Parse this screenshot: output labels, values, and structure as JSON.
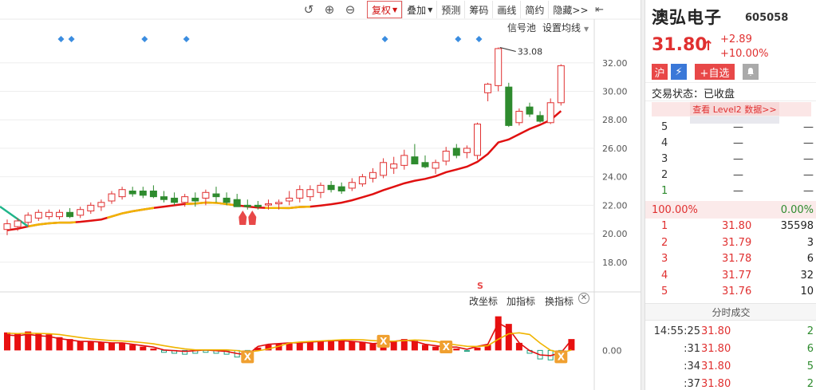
{
  "toolbar": {
    "undo_icon": "undo-icon",
    "zoom_in_icon": "zoom-in-icon",
    "zoom_out_icon": "zoom-out-icon",
    "buttons": [
      "复权",
      "叠加",
      "预测",
      "筹码",
      "画线",
      "简约",
      "隐藏>>"
    ]
  },
  "chart_labels": {
    "signal_pool": "信号池",
    "ma_settings": "设置均线",
    "peak_label": "33.08",
    "change_axis": "改坐标",
    "add_indicator": "加指标",
    "switch_indicator": "换指标",
    "s_marker": "S"
  },
  "colors": {
    "up": "#e03030",
    "down": "#2e8b2e",
    "ma_red": "#e01010",
    "ma_yellow": "#f0b400",
    "diamond": "#3b8de0"
  },
  "chart_data": [
    {
      "type": "candlestick",
      "yticks": [
        "32.00",
        "30.00",
        "28.00",
        "26.00",
        "24.00",
        "22.00",
        "20.00",
        "18.00"
      ],
      "ylim": [
        16.7,
        33.5
      ],
      "peak": 33.08,
      "candles": [
        {
          "o": 20.3,
          "h": 21.0,
          "l": 19.9,
          "c": 20.7
        },
        {
          "o": 20.5,
          "h": 21.1,
          "l": 20.2,
          "c": 20.9
        },
        {
          "o": 20.8,
          "h": 21.5,
          "l": 20.5,
          "c": 21.3
        },
        {
          "o": 21.1,
          "h": 21.7,
          "l": 20.9,
          "c": 21.5
        },
        {
          "o": 21.2,
          "h": 21.7,
          "l": 21.0,
          "c": 21.5
        },
        {
          "o": 21.2,
          "h": 21.7,
          "l": 21.0,
          "c": 21.5
        },
        {
          "o": 21.5,
          "h": 21.8,
          "l": 21.1,
          "c": 21.2
        },
        {
          "o": 21.3,
          "h": 21.9,
          "l": 21.1,
          "c": 21.7
        },
        {
          "o": 21.6,
          "h": 22.2,
          "l": 21.4,
          "c": 22.0
        },
        {
          "o": 21.9,
          "h": 22.4,
          "l": 21.6,
          "c": 22.2
        },
        {
          "o": 22.3,
          "h": 23.0,
          "l": 22.1,
          "c": 22.8
        },
        {
          "o": 22.6,
          "h": 23.3,
          "l": 22.4,
          "c": 23.1
        },
        {
          "o": 23.0,
          "h": 23.3,
          "l": 22.6,
          "c": 22.8
        },
        {
          "o": 23.0,
          "h": 23.3,
          "l": 22.5,
          "c": 22.7
        },
        {
          "o": 23.0,
          "h": 23.4,
          "l": 22.5,
          "c": 22.6
        },
        {
          "o": 22.6,
          "h": 23.0,
          "l": 22.2,
          "c": 22.4
        },
        {
          "o": 22.5,
          "h": 22.9,
          "l": 22.0,
          "c": 22.2
        },
        {
          "o": 22.2,
          "h": 22.8,
          "l": 21.9,
          "c": 22.6
        },
        {
          "o": 22.5,
          "h": 22.9,
          "l": 21.9,
          "c": 22.3
        },
        {
          "o": 22.5,
          "h": 23.1,
          "l": 22.0,
          "c": 22.9
        },
        {
          "o": 22.8,
          "h": 23.3,
          "l": 22.2,
          "c": 22.6
        },
        {
          "o": 22.5,
          "h": 22.9,
          "l": 22.0,
          "c": 22.2
        },
        {
          "o": 22.4,
          "h": 22.8,
          "l": 22.0,
          "c": 21.9
        },
        {
          "o": 22.0,
          "h": 22.4,
          "l": 21.7,
          "c": 21.9
        },
        {
          "o": 22.0,
          "h": 22.3,
          "l": 21.7,
          "c": 21.9
        },
        {
          "o": 22.1,
          "h": 22.4,
          "l": 21.7,
          "c": 22.1
        },
        {
          "o": 22.1,
          "h": 22.4,
          "l": 21.7,
          "c": 22.2
        },
        {
          "o": 22.3,
          "h": 23.0,
          "l": 22.0,
          "c": 22.5
        },
        {
          "o": 22.5,
          "h": 23.4,
          "l": 22.2,
          "c": 23.1
        },
        {
          "o": 22.6,
          "h": 23.4,
          "l": 22.3,
          "c": 23.1
        },
        {
          "o": 22.9,
          "h": 23.6,
          "l": 22.5,
          "c": 23.4
        },
        {
          "o": 23.4,
          "h": 23.7,
          "l": 22.9,
          "c": 23.1
        },
        {
          "o": 23.3,
          "h": 23.6,
          "l": 22.8,
          "c": 23.0
        },
        {
          "o": 23.2,
          "h": 23.9,
          "l": 23.0,
          "c": 23.6
        },
        {
          "o": 23.5,
          "h": 24.2,
          "l": 23.3,
          "c": 24.0
        },
        {
          "o": 23.9,
          "h": 24.6,
          "l": 23.6,
          "c": 24.3
        },
        {
          "o": 24.1,
          "h": 25.3,
          "l": 23.9,
          "c": 25.0
        },
        {
          "o": 24.6,
          "h": 25.4,
          "l": 24.2,
          "c": 24.9
        },
        {
          "o": 24.8,
          "h": 25.9,
          "l": 24.5,
          "c": 25.5
        },
        {
          "o": 25.4,
          "h": 26.3,
          "l": 25.0,
          "c": 24.9
        },
        {
          "o": 25.0,
          "h": 25.5,
          "l": 24.6,
          "c": 24.7
        },
        {
          "o": 24.6,
          "h": 25.2,
          "l": 24.2,
          "c": 25.0
        },
        {
          "o": 25.1,
          "h": 26.1,
          "l": 24.8,
          "c": 25.8
        },
        {
          "o": 26.0,
          "h": 26.3,
          "l": 25.3,
          "c": 25.5
        },
        {
          "o": 25.7,
          "h": 26.2,
          "l": 25.3,
          "c": 26.0
        },
        {
          "o": 25.5,
          "h": 27.8,
          "l": 25.2,
          "c": 27.7
        },
        {
          "o": 29.9,
          "h": 30.6,
          "l": 29.3,
          "c": 30.5
        },
        {
          "o": 30.4,
          "h": 33.08,
          "l": 30.0,
          "c": 33.0
        },
        {
          "o": 30.3,
          "h": 30.6,
          "l": 27.5,
          "c": 27.6
        },
        {
          "o": 27.8,
          "h": 28.8,
          "l": 27.6,
          "c": 28.6
        },
        {
          "o": 28.9,
          "h": 29.2,
          "l": 28.2,
          "c": 28.4
        },
        {
          "o": 28.3,
          "h": 28.6,
          "l": 27.8,
          "c": 27.9
        },
        {
          "o": 27.8,
          "h": 29.5,
          "l": 27.7,
          "c": 29.2
        },
        {
          "o": 29.2,
          "h": 31.9,
          "l": 29.0,
          "c": 31.8
        }
      ],
      "diamonds_at": [
        5,
        6,
        13,
        17,
        36,
        43,
        45
      ],
      "rockets_at": [
        23
      ]
    },
    {
      "type": "bar",
      "ytick": "0.00",
      "ylim": [
        -1.5,
        2.5
      ],
      "values": [
        0.95,
        0.9,
        1.0,
        0.9,
        0.85,
        0.7,
        0.6,
        0.5,
        0.5,
        0.45,
        0.4,
        0.4,
        0.3,
        0.2,
        0.1,
        -0.1,
        -0.15,
        -0.2,
        -0.15,
        -0.1,
        -0.15,
        -0.2,
        -0.35,
        -0.45,
        0.15,
        0.3,
        0.35,
        0.4,
        0.4,
        0.45,
        0.5,
        0.55,
        0.55,
        0.5,
        0.45,
        0.35,
        0.4,
        0.5,
        0.6,
        0.5,
        0.3,
        0.2,
        0.1,
        0.1,
        -0.05,
        0.15,
        0.3,
        1.8,
        1.4,
        0.4,
        -0.15,
        -0.45,
        -0.5,
        -0.3,
        0.6
      ],
      "x_markers_at": [
        23,
        36,
        42,
        53
      ]
    }
  ],
  "panel": {
    "name": "澳弘电子",
    "code": "605058",
    "price": "31.80",
    "arrow": "↑",
    "change": "+2.89",
    "change_pct": "+10.00%",
    "badge_market": "沪",
    "badge_flash": "⚡",
    "add_watch": "+自选",
    "bell_icon": "bell-icon",
    "status": "交易状态：已收盘",
    "level2": "查看 Level2 数据>>",
    "asks": [
      {
        "idx": "5",
        "price": "—",
        "vol": "—"
      },
      {
        "idx": "4",
        "price": "—",
        "vol": "—"
      },
      {
        "idx": "3",
        "price": "—",
        "vol": "—"
      },
      {
        "idx": "2",
        "price": "—",
        "vol": "—"
      },
      {
        "idx": "1",
        "price": "—",
        "vol": "—"
      }
    ],
    "ratio_left": "100.00%",
    "ratio_right": "0.00%",
    "bids": [
      {
        "idx": "1",
        "price": "31.80",
        "vol": "35598"
      },
      {
        "idx": "2",
        "price": "31.79",
        "vol": "3"
      },
      {
        "idx": "3",
        "price": "31.78",
        "vol": "6"
      },
      {
        "idx": "4",
        "price": "31.77",
        "vol": "32"
      },
      {
        "idx": "5",
        "price": "31.76",
        "vol": "10"
      }
    ],
    "ticks_title": "分时成交",
    "ticks": [
      {
        "time": "14:55:25",
        "price": "31.80",
        "vol": "2"
      },
      {
        "time": ":31",
        "price": "31.80",
        "vol": "6"
      },
      {
        "time": ":34",
        "price": "31.80",
        "vol": "5"
      },
      {
        "time": ":37",
        "price": "31.80",
        "vol": "2"
      }
    ]
  }
}
